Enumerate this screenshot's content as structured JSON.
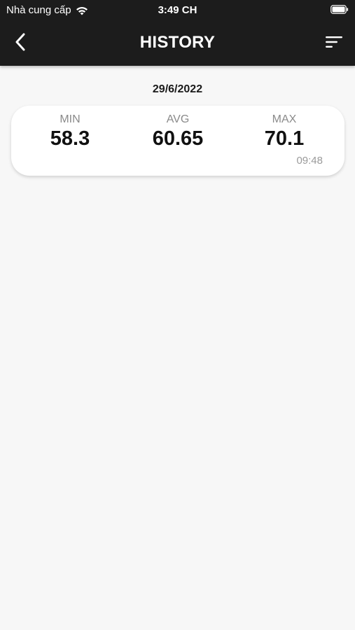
{
  "status_bar": {
    "carrier": "Nhà cung cấp",
    "time": "3:49 CH",
    "wifi_icon": "wifi-icon",
    "battery_icon": "battery-icon"
  },
  "nav": {
    "title": "HISTORY",
    "back_icon": "chevron-left-icon",
    "sort_icon": "sort-icon"
  },
  "history": [
    {
      "date": "29/6/2022",
      "min_label": "MIN",
      "min_value": "58.3",
      "avg_label": "AVG",
      "avg_value": "60.65",
      "max_label": "MAX",
      "max_value": "70.1",
      "time": "09:48"
    }
  ],
  "colors": {
    "header_bg": "#1c1c1c",
    "page_bg": "#f7f7f7",
    "card_bg": "#ffffff"
  }
}
